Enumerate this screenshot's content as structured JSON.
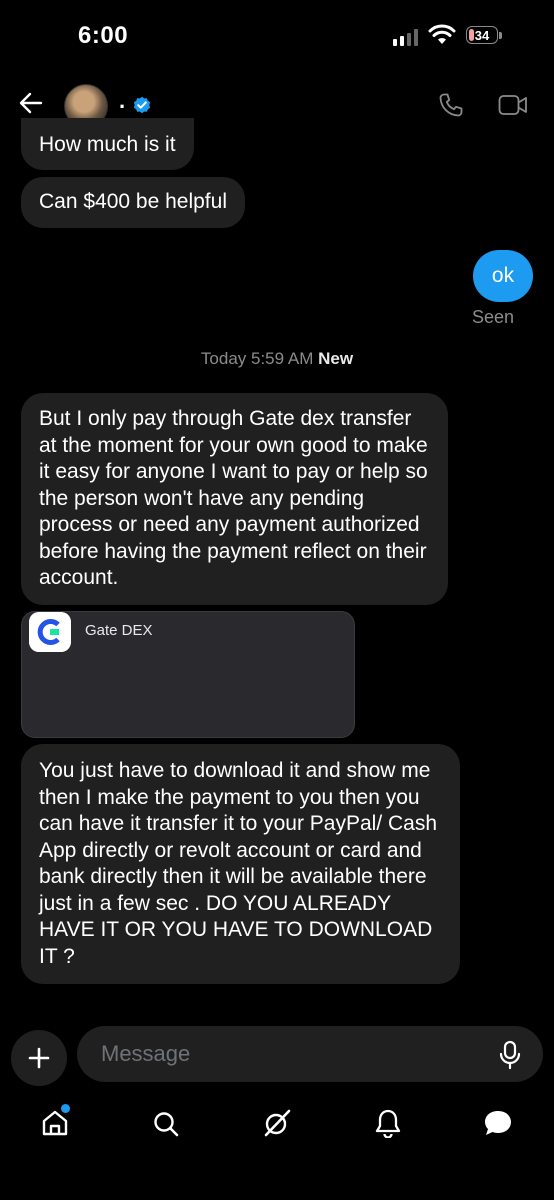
{
  "status_bar": {
    "time": "6:00",
    "battery": "34"
  },
  "header": {
    "name": "."
  },
  "messages": [
    {
      "text": "How much is it",
      "direction": "in"
    },
    {
      "text": "Can $400 be helpful",
      "direction": "in"
    },
    {
      "text": "ok",
      "direction": "out"
    },
    {
      "text": "But I only pay through Gate dex transfer at the moment for your own good to make it easy for anyone I want to pay or help so the person won't  have any pending process or need any payment authorized  before having the payment reflect on their account.",
      "direction": "in"
    },
    {
      "text": "You just have to download it and show me  then I make the payment to you then you can have it transfer it to your PayPal/ Cash App directly or revolt account or card and bank directly then it will be available there just in a few sec .   DO YOU ALREADY HAVE IT OR YOU HAVE TO DOWNLOAD IT ?",
      "direction": "in"
    }
  ],
  "seen_label": "Seen",
  "day_separator": {
    "time": "Today 5:59 AM",
    "new_label": "New"
  },
  "link_card": {
    "title": "Gate DEX"
  },
  "composer": {
    "placeholder": "Message"
  },
  "colors": {
    "accent": "#1d9bf0",
    "bubble_in": "#202020",
    "background": "#000000"
  },
  "icons": [
    "back-arrow-icon",
    "verified-badge-icon",
    "phone-icon",
    "video-icon",
    "plus-icon",
    "microphone-icon",
    "home-icon",
    "search-icon",
    "grok-icon",
    "bell-icon",
    "messages-icon"
  ]
}
